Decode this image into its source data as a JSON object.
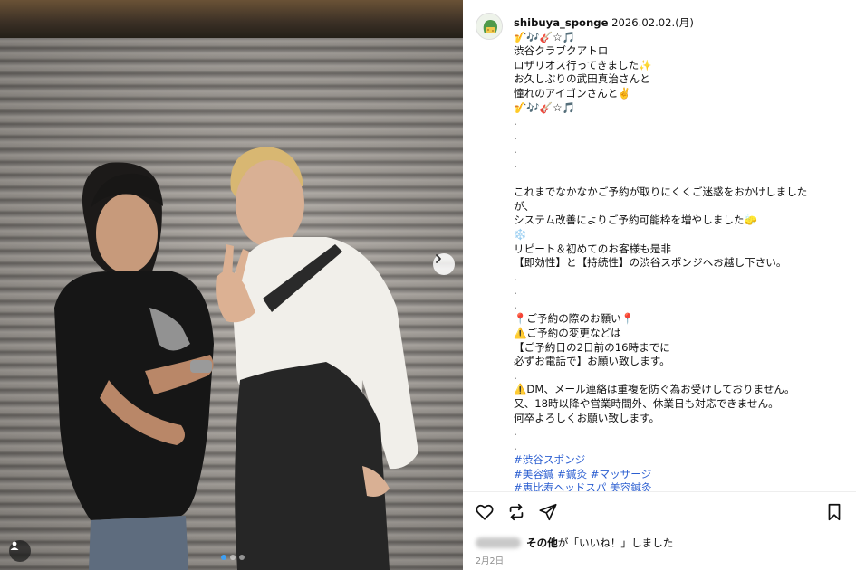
{
  "post": {
    "username": "shibuya_sponge",
    "date_line": " 2026.02.02.(月)",
    "caption": "🎷🎶🎸☆🎵\n渋谷クラブクアトロ\nロザリオス行ってきました✨\nお久しぶりの武田真治さんと\n憧れのアイゴンさんと✌️\n🎷🎶🎸☆🎵\n.\n.\n.\n.\n\nこれまでなかなかご予約が取りにくくご迷惑をおかけしました\nが、\nシステム改善によりご予約可能枠を増やしました🧽\n❄️\nリピート＆初めてのお客様も是非\n【即効性】と【持続性】の渋谷スポンジへお越し下さい。\n.\n.\n.\n📍ご予約の際のお願い📍\n⚠️ご予約の変更などは\n【ご予約日の2日前の16時までに\n必ずお電話で】お願い致します。\n.\n⚠️DM、メール連絡は重複を防ぐ為お受けしておりません。\n又、18時以降や営業時間外、休業日も対応できません。\n何卒よろしくお願い致します。\n.\n.",
    "hashtags": [
      "#渋谷スポンジ",
      "#美容鍼 #鍼灸 #マッサージ",
      "#恵比寿ヘッドスパ 美容鍼灸"
    ]
  },
  "likes": {
    "others": "その他",
    "suffix": "が「いいね！」しました"
  },
  "post_date": "2月2日",
  "carousel": {
    "count": 3,
    "active": 0
  },
  "icons": {
    "like": "heart-icon",
    "comment": "comment-icon",
    "share": "send-icon",
    "save": "bookmark-icon",
    "next": "chevron-right-icon",
    "tag": "user-icon"
  },
  "colors": {
    "hashtag": "#2c5fd1",
    "active_dot": "#3ea0f5"
  }
}
